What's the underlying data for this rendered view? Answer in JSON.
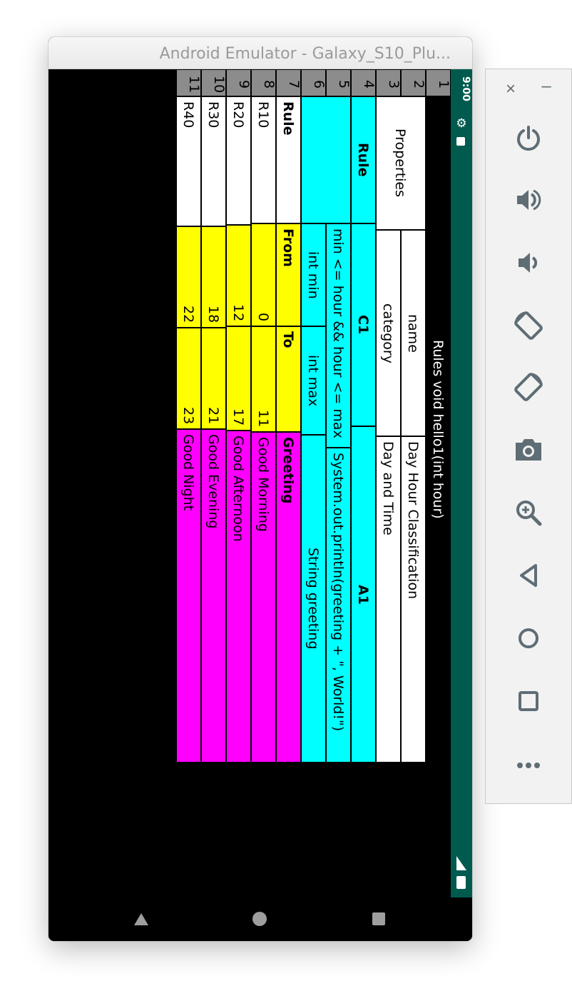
{
  "window": {
    "title": "Android Emulator - Galaxy_S10_Plu..."
  },
  "status_bar": {
    "time": "9:00",
    "icons": [
      "gear-icon",
      "notification-icon",
      "signal-icon",
      "battery-icon"
    ]
  },
  "navigation_bar": {
    "icons": [
      "back-icon",
      "home-icon",
      "recents-icon"
    ]
  },
  "spreadsheet": {
    "row_numbers": [
      "1",
      "2",
      "3",
      "4",
      "5",
      "6",
      "7",
      "8",
      "9",
      "10",
      "11"
    ],
    "row1": {
      "title": "Rules void hello1(int hour)"
    },
    "properties": {
      "label": "Properties",
      "name_key": "name",
      "name_value": "Day Hour Classification",
      "category_key": "category",
      "category_value": "Day and Time"
    },
    "row4": {
      "rule": "Rule",
      "c1": "C1",
      "a1": "A1"
    },
    "row5": {
      "condition": "min <= hour && hour <= max",
      "action": "System.out.println(greeting + \", World!\")"
    },
    "row6": {
      "min": "int min",
      "max": "int max",
      "greeting": "String greeting"
    },
    "row7": {
      "rule": "Rule",
      "from": "From",
      "to": "To",
      "greeting": "Greeting"
    },
    "rules": [
      {
        "rule": "R10",
        "from": "0",
        "to": "11",
        "greeting": "Good Morning"
      },
      {
        "rule": "R20",
        "from": "12",
        "to": "17",
        "greeting": "Good Afternoon"
      },
      {
        "rule": "R30",
        "from": "18",
        "to": "21",
        "greeting": "Good Evening"
      },
      {
        "rule": "R40",
        "from": "22",
        "to": "23",
        "greeting": "Good Night"
      }
    ],
    "colors": {
      "header": "#8c8c8c",
      "cyan": "#00ffff",
      "yellow": "#ffff00",
      "magenta": "#ff00ff"
    }
  },
  "toolbar": {
    "close": "×",
    "minimize": "–",
    "buttons": [
      "power-icon",
      "volume-up-icon",
      "volume-down-icon",
      "rotate-left-icon",
      "rotate-right-icon",
      "camera-icon",
      "zoom-icon",
      "back-icon",
      "home-icon",
      "overview-icon",
      "more-icon"
    ]
  }
}
